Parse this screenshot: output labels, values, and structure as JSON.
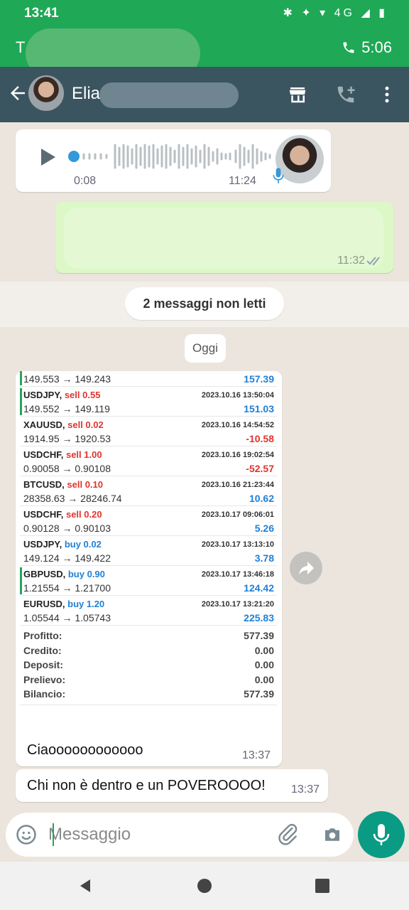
{
  "status_bar": {
    "time": "13:41",
    "icons": "✱ ✦ ▾ 4G ◢ ▮"
  },
  "call_banner": {
    "title": "T",
    "timer": "5:06"
  },
  "header": {
    "contact_name": "Elia"
  },
  "voice_note": {
    "duration": "0:08",
    "time": "11:24"
  },
  "outgoing": {
    "time": "11:32"
  },
  "unread_banner": "2 messaggi non letti",
  "date_chip": "Oggi",
  "report": {
    "rows": [
      {
        "symbol": "",
        "side": "",
        "prices": "149.553 → 149.243",
        "datetime": "",
        "pnl": "157.39",
        "pnl_sign": "pos",
        "partial": true,
        "bar": true
      },
      {
        "symbol": "USDJPY,",
        "side": "sell 0.55",
        "side_type": "sell",
        "prices": "149.552 → 149.119",
        "datetime": "2023.10.16 13:50:04",
        "pnl": "151.03",
        "pnl_sign": "pos",
        "bar": true
      },
      {
        "symbol": "XAUUSD,",
        "side": "sell 0.02",
        "side_type": "sell",
        "prices": "1914.95 → 1920.53",
        "datetime": "2023.10.16 14:54:52",
        "pnl": "-10.58",
        "pnl_sign": "neg"
      },
      {
        "symbol": "USDCHF,",
        "side": "sell 1.00",
        "side_type": "sell",
        "prices": "0.90058 → 0.90108",
        "datetime": "2023.10.16 19:02:54",
        "pnl": "-52.57",
        "pnl_sign": "neg"
      },
      {
        "symbol": "BTCUSD,",
        "side": "sell 0.10",
        "side_type": "sell",
        "prices": "28358.63 → 28246.74",
        "datetime": "2023.10.16 21:23:44",
        "pnl": "10.62",
        "pnl_sign": "pos"
      },
      {
        "symbol": "USDCHF,",
        "side": "sell 0.20",
        "side_type": "sell",
        "prices": "0.90128 → 0.90103",
        "datetime": "2023.10.17 09:06:01",
        "pnl": "5.26",
        "pnl_sign": "pos"
      },
      {
        "symbol": "USDJPY,",
        "side": "buy 0.02",
        "side_type": "buy",
        "prices": "149.124 → 149.422",
        "datetime": "2023.10.17 13:13:10",
        "pnl": "3.78",
        "pnl_sign": "pos"
      },
      {
        "symbol": "GBPUSD,",
        "side": "buy 0.90",
        "side_type": "buy",
        "prices": "1.21554 → 1.21700",
        "datetime": "2023.10.17 13:46:18",
        "pnl": "124.42",
        "pnl_sign": "pos",
        "bar": true
      },
      {
        "symbol": "EURUSD,",
        "side": "buy 1.20",
        "side_type": "buy",
        "prices": "1.05544 → 1.05743",
        "datetime": "2023.10.17 13:21:20",
        "pnl": "225.83",
        "pnl_sign": "pos"
      }
    ],
    "summary": [
      {
        "label": "Profitto:",
        "value": "577.39"
      },
      {
        "label": "Credito:",
        "value": "0.00"
      },
      {
        "label": "Deposit:",
        "value": "0.00"
      },
      {
        "label": "Prelievo:",
        "value": "0.00"
      },
      {
        "label": "Bilancio:",
        "value": "577.39"
      }
    ],
    "message": "Ciaoooooooooooo",
    "time": "13:37"
  },
  "message2": {
    "text": "Chi non è dentro e un POVEROOOO!",
    "time": "13:37"
  },
  "composer": {
    "placeholder": "Messaggio"
  },
  "colors": {
    "whatsapp_green": "#1fa855",
    "header": "#3b5560",
    "sell": "#e0342e",
    "buy": "#1f7fd6",
    "mic": "#0a9b84"
  }
}
